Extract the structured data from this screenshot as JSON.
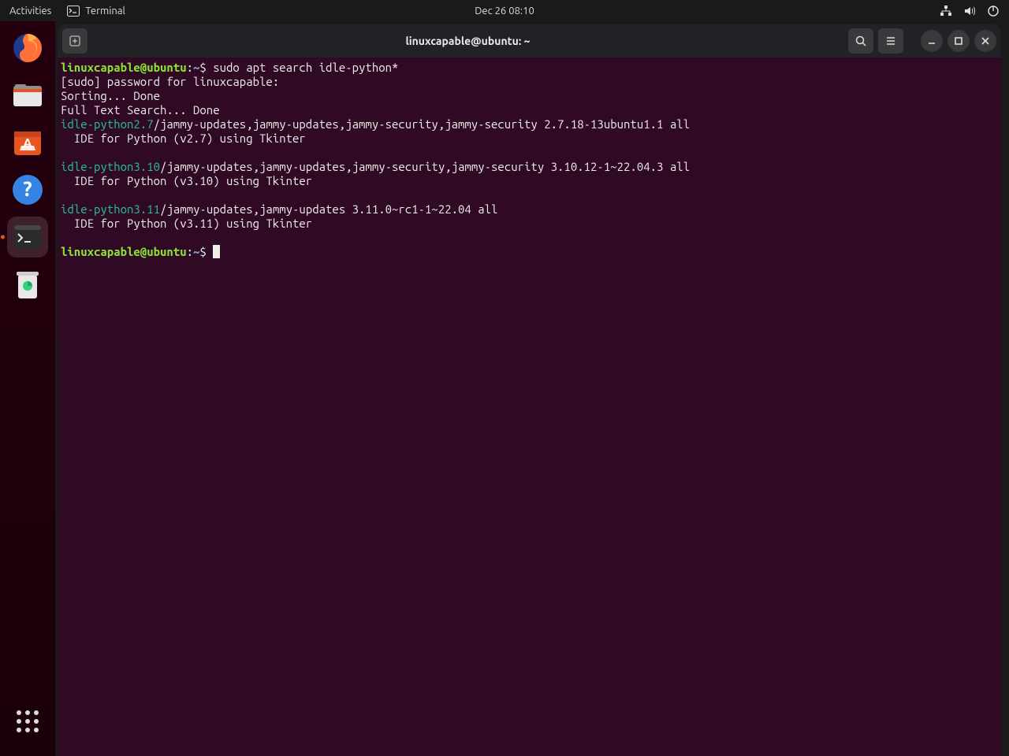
{
  "top_panel": {
    "activities": "Activities",
    "app_name": "Terminal",
    "datetime": "Dec 26  08:10"
  },
  "dock": {
    "items": [
      {
        "name": "firefox"
      },
      {
        "name": "files"
      },
      {
        "name": "software"
      },
      {
        "name": "help"
      },
      {
        "name": "terminal",
        "active": true
      },
      {
        "name": "trash"
      }
    ],
    "show_apps": "Show Applications"
  },
  "window": {
    "title": "linuxcapable@ubuntu: ~"
  },
  "terminal": {
    "prompt_user": "linuxcapable@ubuntu",
    "prompt_sep1": ":",
    "prompt_path": "~",
    "prompt_sep2": "$ ",
    "command": "sudo apt search idle-python*",
    "line_sudo": "[sudo] password for linuxcapable: ",
    "line_sorting": "Sorting... Done",
    "line_fts": "Full Text Search... Done",
    "results": [
      {
        "pkg": "idle-python2.7",
        "meta": "/jammy-updates,jammy-updates,jammy-security,jammy-security 2.7.18-13ubuntu1.1 all",
        "desc": "  IDE for Python (v2.7) using Tkinter"
      },
      {
        "pkg": "idle-python3.10",
        "meta": "/jammy-updates,jammy-updates,jammy-security,jammy-security 3.10.12-1~22.04.3 all",
        "desc": "  IDE for Python (v3.10) using Tkinter"
      },
      {
        "pkg": "idle-python3.11",
        "meta": "/jammy-updates,jammy-updates 3.11.0~rc1-1~22.04 all",
        "desc": "  IDE for Python (v3.11) using Tkinter"
      }
    ]
  }
}
